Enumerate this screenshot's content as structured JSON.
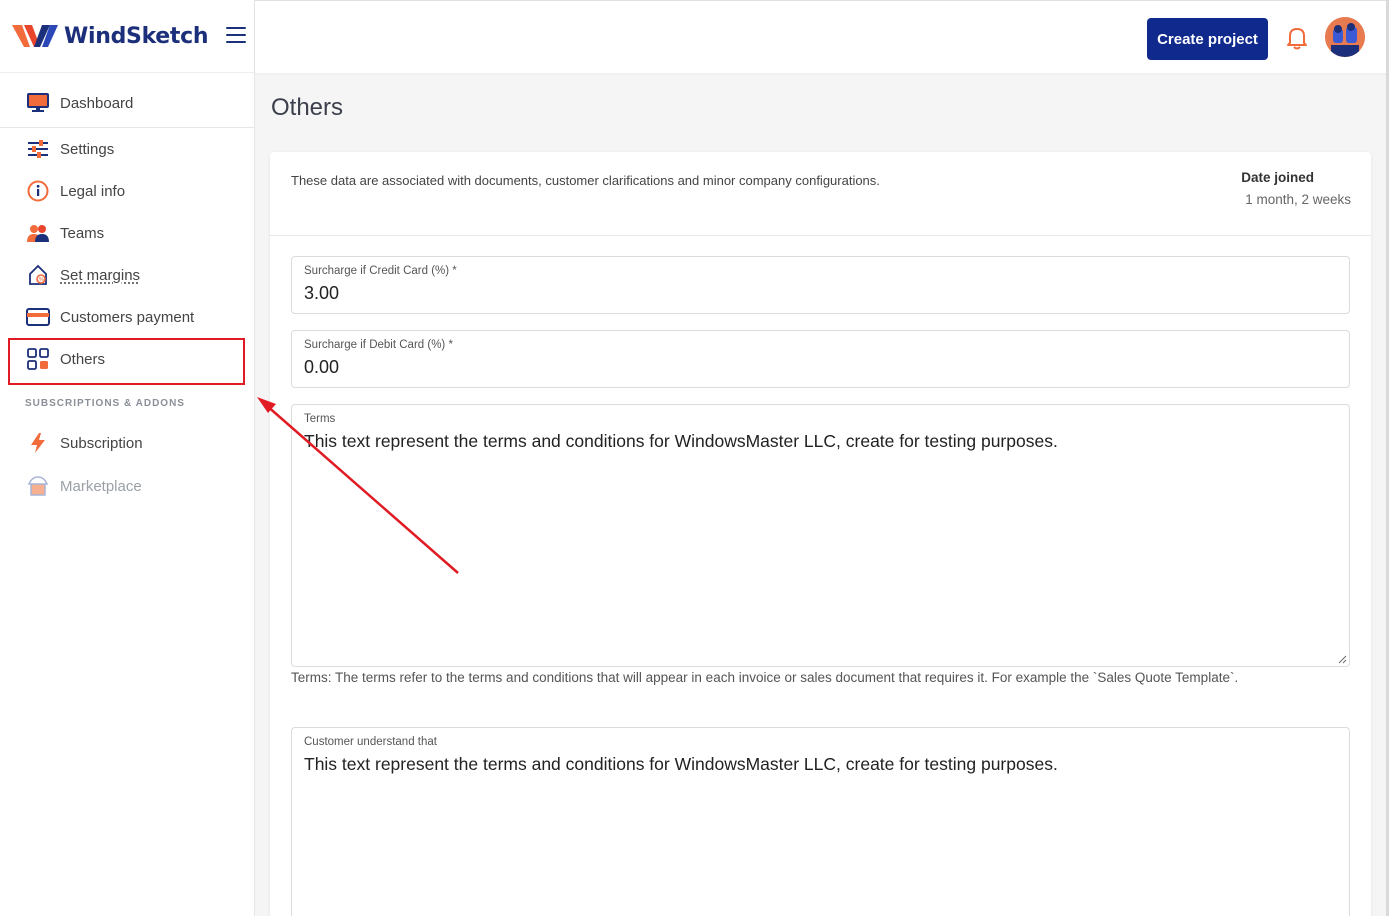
{
  "brand": {
    "name": "WindSketch"
  },
  "sidebar": {
    "items": [
      {
        "label": "Dashboard",
        "icon": "monitor-icon"
      },
      {
        "label": "Settings",
        "icon": "sliders-icon"
      },
      {
        "label": "Legal info",
        "icon": "info-icon"
      },
      {
        "label": "Teams",
        "icon": "users-icon"
      },
      {
        "label": "Set margins",
        "icon": "margins-icon"
      },
      {
        "label": "Customers payment",
        "icon": "credit-card-icon"
      },
      {
        "label": "Others",
        "icon": "grid-icon",
        "active": true
      }
    ],
    "section_title": "SUBSCRIPTIONS & ADDONS",
    "addons": [
      {
        "label": "Subscription",
        "icon": "bolt-icon"
      },
      {
        "label": "Marketplace",
        "icon": "store-icon",
        "disabled": true
      }
    ]
  },
  "header": {
    "create_label": "Create project",
    "notification_icon": "bell-icon"
  },
  "main": {
    "title": "Others",
    "description": "These data are associated with documents, customer clarifications and minor company configurations.",
    "date_joined_label": "Date joined",
    "date_joined_value": "1 month, 2 weeks",
    "fields": {
      "credit": {
        "label": "Surcharge if Credit Card (%) *",
        "value": "3.00"
      },
      "debit": {
        "label": "Surcharge if Debit Card (%) *",
        "value": "0.00"
      },
      "terms": {
        "label": "Terms",
        "value": "This text represent the terms and conditions for WindowsMaster LLC, create for testing purposes."
      },
      "terms_help": " Terms: The terms refer to the terms and conditions that will appear in each invoice or sales document that requires it. For example the `Sales Quote Template`.",
      "understand": {
        "label": "Customer understand that",
        "value": "This text represent the terms and conditions for WindowsMaster LLC, create for testing purposes."
      }
    }
  },
  "colors": {
    "brand_navy": "#10298c",
    "accent_orange": "#f26b3a",
    "annotation_red": "#e01b24"
  }
}
